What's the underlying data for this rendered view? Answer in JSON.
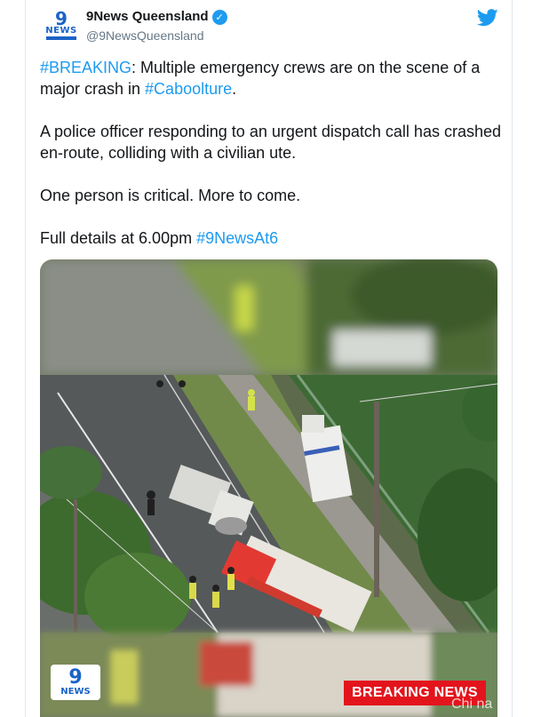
{
  "tweet": {
    "display_name": "9News Queensland",
    "handle": "@9NewsQueensland",
    "avatar_icon": "9news-logo-icon",
    "avatar_logo_number": "9",
    "avatar_logo_word": "NEWS",
    "platform_icon": "twitter-bird-icon",
    "verified_icon": "verified-badge-icon",
    "link_color": "#1d9bf0",
    "paragraphs": [
      {
        "tag1": "#BREAKING",
        "text1": ": Multiple emergency crews are on the scene of a major crash in ",
        "tag2": "#Caboolture",
        "text2": "."
      },
      {
        "text": "A police officer responding to an urgent dispatch call has crashed en-route, colliding with a civilian ute."
      },
      {
        "text": "One person is critical. More to come."
      },
      {
        "text": "Full details at 6.00pm ",
        "tag": "#9NewsAt6"
      }
    ]
  },
  "media": {
    "logo_number": "9",
    "logo_word": "NEWS",
    "banner": "BREAKING NEWS",
    "banner_color": "#e3141c",
    "watermark": "Chi na"
  }
}
